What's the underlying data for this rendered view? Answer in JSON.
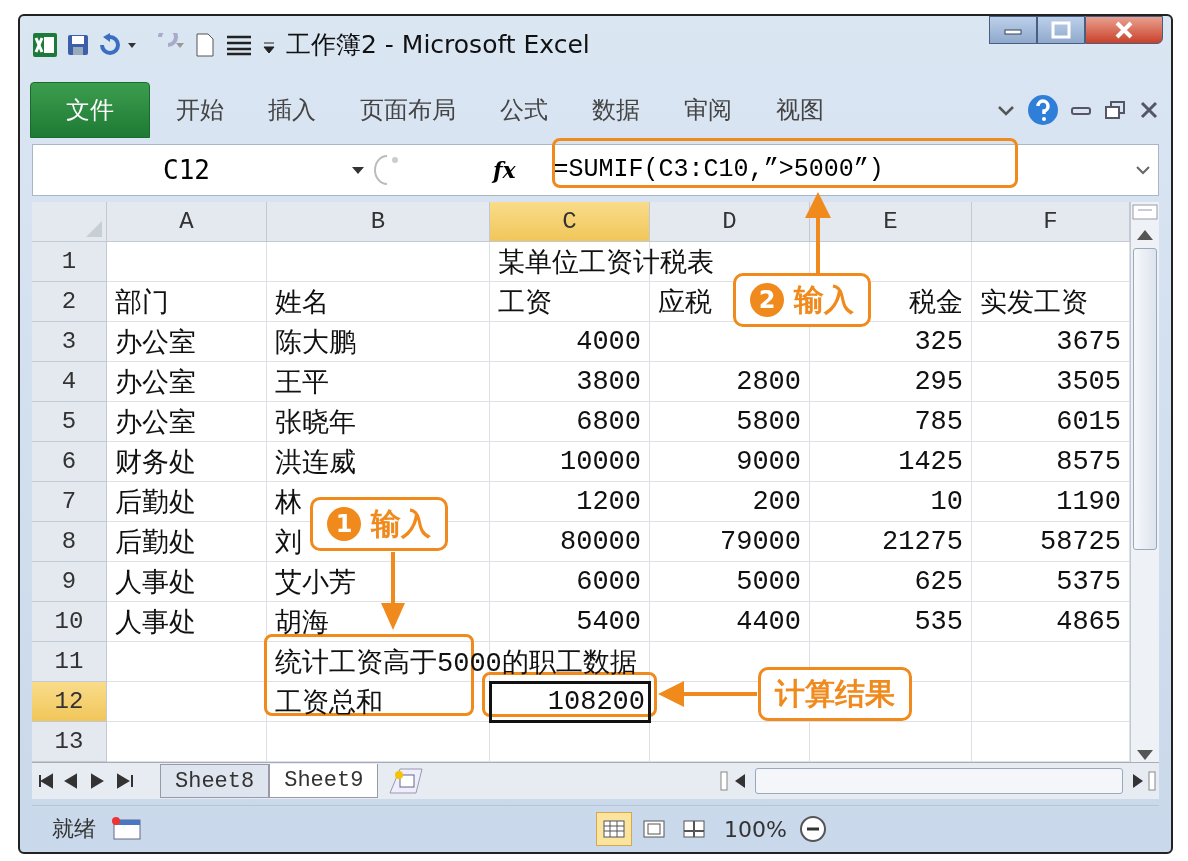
{
  "window": {
    "title": "工作簿2 - Microsoft Excel"
  },
  "ribbon": {
    "file_tab": "文件",
    "tabs": [
      {
        "label": "开始",
        "selected": false
      },
      {
        "label": "插入",
        "selected": false
      },
      {
        "label": "页面布局",
        "selected": false
      },
      {
        "label": "公式",
        "selected": false
      },
      {
        "label": "数据",
        "selected": false
      },
      {
        "label": "审阅",
        "selected": false
      },
      {
        "label": "视图",
        "selected": false
      }
    ]
  },
  "formula_bar": {
    "name_box": "C12",
    "function_label": "fx",
    "formula": "=SUMIF(C3:C10,”>5000”)"
  },
  "columns": [
    {
      "label": "A",
      "selected": false
    },
    {
      "label": "B",
      "selected": false
    },
    {
      "label": "C",
      "selected": true
    },
    {
      "label": "D",
      "selected": false
    },
    {
      "label": "E",
      "selected": false
    },
    {
      "label": "F",
      "selected": false
    }
  ],
  "rows": [
    {
      "number": "1",
      "selected": false,
      "cells": [
        null,
        null,
        {
          "text": "某单位工资计税表"
        },
        null,
        null,
        null
      ]
    },
    {
      "number": "2",
      "selected": false,
      "cells": [
        {
          "text": "部门"
        },
        {
          "text": "姓名"
        },
        {
          "text": "工资"
        },
        {
          "text": "应税"
        },
        {
          "text": "税金",
          "right_aligned": true
        },
        {
          "text": "实发工资"
        }
      ]
    },
    {
      "number": "3",
      "selected": false,
      "cells": [
        {
          "text": "办公室"
        },
        {
          "text": "陈大鹏"
        },
        {
          "text": "4000"
        },
        null,
        {
          "text": "325"
        },
        {
          "text": "3675"
        }
      ]
    },
    {
      "number": "4",
      "selected": false,
      "cells": [
        {
          "text": "办公室"
        },
        {
          "text": "王平"
        },
        {
          "text": "3800"
        },
        {
          "text": "2800"
        },
        {
          "text": "295"
        },
        {
          "text": "3505"
        }
      ]
    },
    {
      "number": "5",
      "selected": false,
      "cells": [
        {
          "text": "办公室"
        },
        {
          "text": "张晓年"
        },
        {
          "text": "6800"
        },
        {
          "text": "5800"
        },
        {
          "text": "785"
        },
        {
          "text": "6015"
        }
      ]
    },
    {
      "number": "6",
      "selected": false,
      "cells": [
        {
          "text": "财务处"
        },
        {
          "text": "洪连威"
        },
        {
          "text": "10000"
        },
        {
          "text": "9000"
        },
        {
          "text": "1425"
        },
        {
          "text": "8575"
        }
      ]
    },
    {
      "number": "7",
      "selected": false,
      "cells": [
        {
          "text": "后勤处"
        },
        {
          "text": "林"
        },
        {
          "text": "1200"
        },
        {
          "text": "200"
        },
        {
          "text": "10"
        },
        {
          "text": "1190"
        }
      ]
    },
    {
      "number": "8",
      "selected": false,
      "cells": [
        {
          "text": "后勤处"
        },
        {
          "text": "刘"
        },
        {
          "text": "80000"
        },
        {
          "text": "79000"
        },
        {
          "text": "21275"
        },
        {
          "text": "58725"
        }
      ]
    },
    {
      "number": "9",
      "selected": false,
      "cells": [
        {
          "text": "人事处"
        },
        {
          "text": "艾小芳"
        },
        {
          "text": "6000"
        },
        {
          "text": "5000"
        },
        {
          "text": "625"
        },
        {
          "text": "5375"
        }
      ]
    },
    {
      "number": "10",
      "selected": false,
      "cells": [
        {
          "text": "人事处"
        },
        {
          "text": "胡海"
        },
        {
          "text": "5400"
        },
        {
          "text": "4400"
        },
        {
          "text": "535"
        },
        {
          "text": "4865"
        }
      ]
    },
    {
      "number": "11",
      "selected": false,
      "cells": [
        null,
        {
          "text": "统计工资高于5000的职工数据"
        },
        null,
        null,
        null,
        null
      ]
    },
    {
      "number": "12",
      "selected": true,
      "cells": [
        null,
        {
          "text": "工资总和"
        },
        {
          "text": "108200"
        },
        null,
        null,
        null
      ]
    },
    {
      "number": "13",
      "selected": false,
      "cells": [
        null,
        null,
        null,
        null,
        null,
        null
      ]
    }
  ],
  "sheet_tabs": [
    {
      "label": "Sheet8",
      "selected": false
    },
    {
      "label": "Sheet9",
      "selected": true
    }
  ],
  "status_bar": {
    "status": "就绪",
    "zoom": "100%"
  },
  "annotations": [
    {
      "kind": "step",
      "number": "1",
      "text": "输入"
    },
    {
      "kind": "step",
      "number": "2",
      "text": "输入"
    },
    {
      "kind": "label",
      "text": "计算结果"
    }
  ]
}
